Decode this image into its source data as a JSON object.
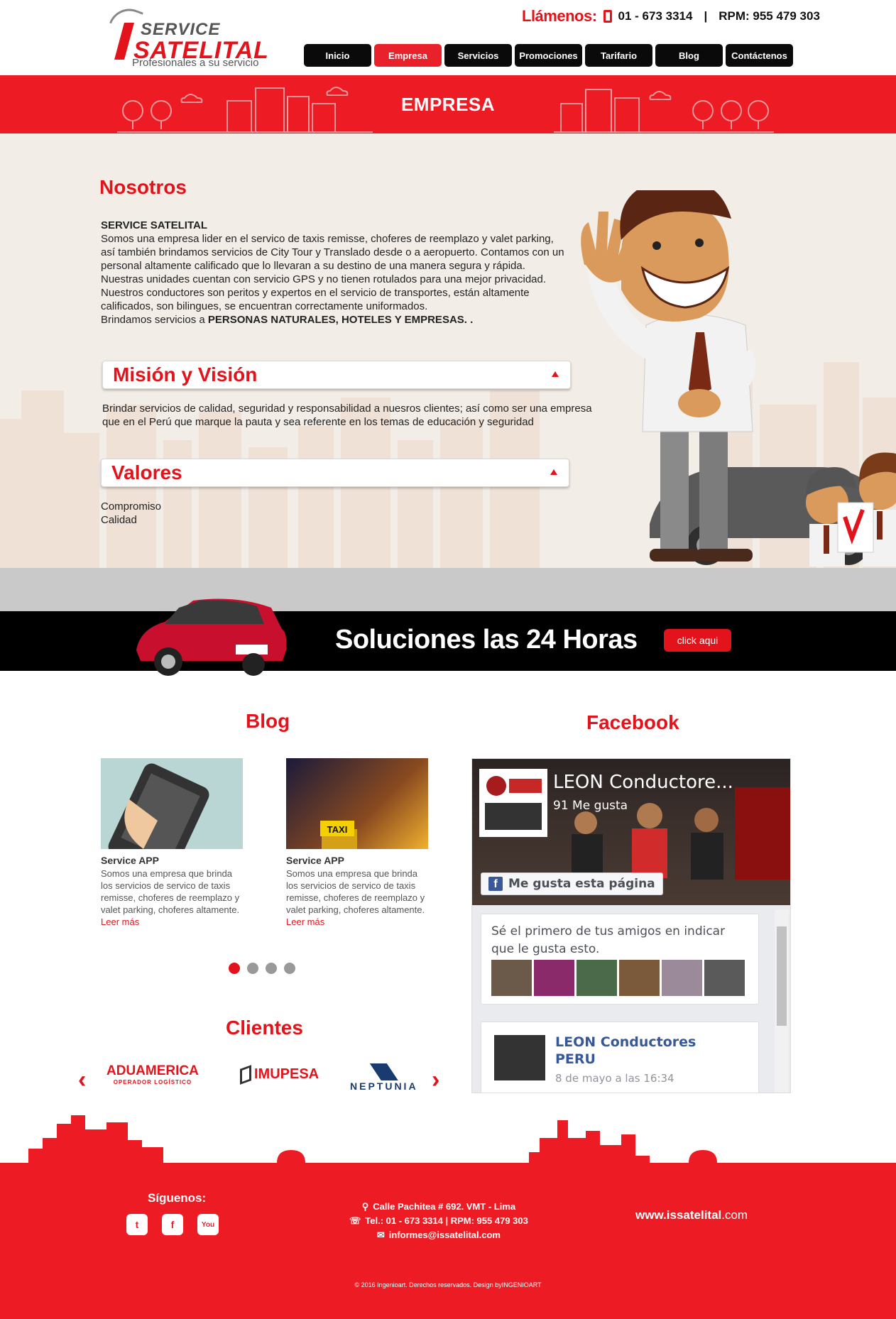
{
  "header": {
    "logo": {
      "top": "SERVICE",
      "main": "SATELITAL",
      "tagline": "Profesionales a su servicio"
    },
    "call_label": "Llámenos:",
    "phone": "01 - 673 3314",
    "rpm": "RPM: 955 479 303",
    "nav": [
      "Inicio",
      "Empresa",
      "Servicios",
      "Promociones",
      "Tarifario",
      "Blog",
      "Contáctenos"
    ]
  },
  "banner": {
    "title": "EMPRESA"
  },
  "about": {
    "heading": "Nosotros",
    "company": "SERVICE SATELITAL",
    "text": "Somos una empresa lider en el servico de taxis remisse, choferes de reemplazo y valet parking, así también brindamos servicios de City Tour y Translado desde o a aeropuerto. Contamos con un personal altamente calificado que lo llevaran a su destino de una manera segura y rápida. Nuestras unidades cuentan con servicio GPS y no tienen rotulados para una mejor privacidad. Nuestros conductores son peritos y expertos en el servicio de transportes, están altamente calificados, son bilingues, se encuentran correctamente uniformados.",
    "clients_prefix": "Brindamos servicios a ",
    "clients_bold": "PERSONAS NATURALES, HOTELES Y EMPRESAS. .",
    "mision_title": "Misión y Visión",
    "mision_text": "Brindar servicios de calidad, seguridad y responsabilidad a nuesros clientes; así como ser una empresa que en el Perú que marque la pauta y sea referente en los temas de educación y seguridad",
    "valores_title": "Valores",
    "valores": [
      "Compromiso",
      "Calidad"
    ]
  },
  "strip": {
    "text": "Soluciones las 24 Horas",
    "button": "click aqui"
  },
  "blog": {
    "heading": "Blog",
    "posts": [
      {
        "title": "Service APP",
        "desc": "Somos una empresa que brinda los servicios de servico de taxis remisse, choferes de reemplazo y valet parking, choferes altamente.",
        "more": "Leer más"
      },
      {
        "title": "Service APP",
        "desc": "Somos una empresa que brinda los servicios de servico de taxis remisse, choferes de reemplazo y valet parking, choferes altamente.",
        "more": "Leer más"
      }
    ],
    "taxi_sign": "TAXI"
  },
  "clientes": {
    "heading": "Clientes",
    "logos": {
      "aduamerica": "ADUAMERICA",
      "aduamerica_sub": "OPERADOR LOGÍSTICO",
      "imupesa": "IMUPESA",
      "neptunia": "NEPTUNIA"
    }
  },
  "facebook": {
    "heading": "Facebook",
    "page_name": "LEON Conductore...",
    "likes": "91 Me gusta",
    "like_button": "Me gusta esta página",
    "friends_text": "Sé el primero de tus amigos en indicar que le gusta esto.",
    "post_name": "LEON Conductores PERU",
    "post_date": "8 de mayo a las 16:34"
  },
  "footer": {
    "follow": "Síguenos:",
    "address": "Calle Pachitea # 692. VMT - Lima",
    "tel": "Tel.: 01 - 673 3314   |   RPM: 955 479 303",
    "email": "informes@issatelital.com",
    "site_bold": "www.issatelital",
    "site_tld": ".com",
    "copyright": "© 2016 Ingenioart. Derechos reservados. Design byINGENIOART",
    "social": [
      "twitter-icon",
      "facebook-icon",
      "youtube-icon"
    ]
  },
  "colors": {
    "brand_red": "#ed1c24",
    "nav_black": "#0a0a0a",
    "about_bg": "#f3ede7"
  }
}
